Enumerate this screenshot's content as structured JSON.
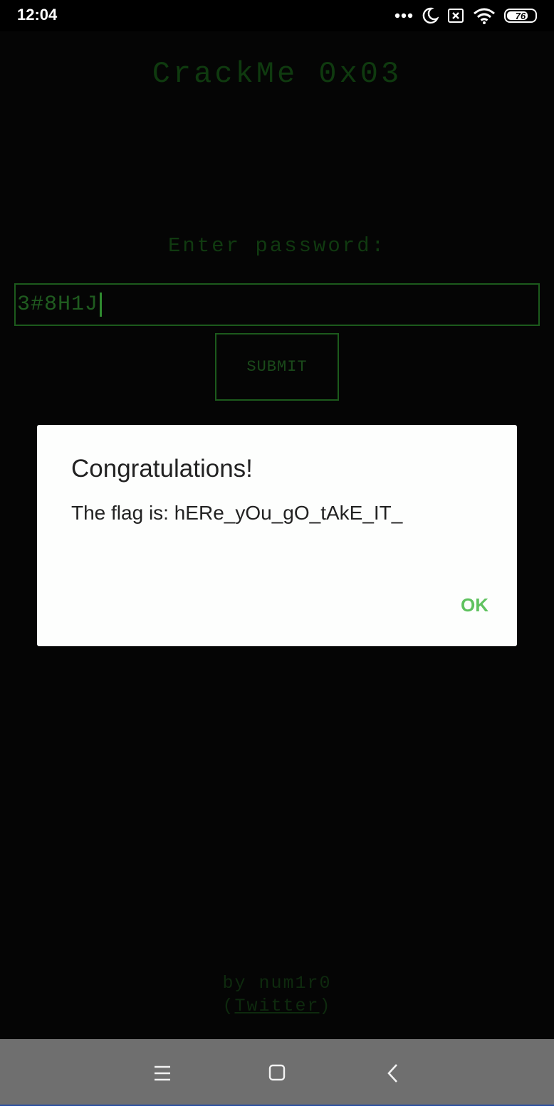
{
  "status_bar": {
    "time": "12:04",
    "battery_level": "76",
    "battery_fraction": 0.76,
    "icons": [
      "more-dots-icon",
      "moon-icon",
      "sim-off-icon",
      "wifi-icon",
      "battery-icon"
    ]
  },
  "app": {
    "title": "CrackMe 0x03",
    "prompt": "Enter password:",
    "password_value": "3#8H1J",
    "submit_label": "SUBMIT",
    "credit_line": "by num1r0",
    "twitter_open": "(",
    "twitter_link": "Twitter",
    "twitter_close": ")"
  },
  "dialog": {
    "title": "Congratulations!",
    "message": "The flag is: hERe_yOu_gO_tAkE_IT_",
    "ok_label": "OK"
  },
  "nav_bar": {
    "icons": [
      "menu-icon",
      "home-icon",
      "back-icon"
    ]
  },
  "colors": {
    "terminal_green": "#1f5b1f",
    "dialog_accent": "#5fc25f",
    "background": "#050505"
  }
}
